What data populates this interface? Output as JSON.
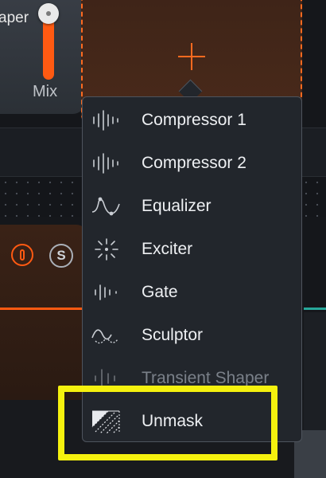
{
  "background": {
    "shaper_label": "aper",
    "mix_label": "Mix",
    "solo_label": "S"
  },
  "menu": {
    "items": [
      {
        "label": "Compressor 1",
        "icon": "compressor-icon",
        "enabled": true
      },
      {
        "label": "Compressor 2",
        "icon": "compressor-icon",
        "enabled": true
      },
      {
        "label": "Equalizer",
        "icon": "equalizer-icon",
        "enabled": true
      },
      {
        "label": "Exciter",
        "icon": "exciter-icon",
        "enabled": true
      },
      {
        "label": "Gate",
        "icon": "gate-icon",
        "enabled": true
      },
      {
        "label": "Sculptor",
        "icon": "sculptor-icon",
        "enabled": true
      },
      {
        "label": "Transient Shaper",
        "icon": "transient-shaper-icon",
        "enabled": false
      },
      {
        "label": "Unmask",
        "icon": "unmask-icon",
        "enabled": true
      }
    ]
  },
  "colors": {
    "accent": "#ff5a12",
    "highlight": "#f5f10e",
    "menu_bg": "#22262c",
    "teal": "#27a89a"
  }
}
